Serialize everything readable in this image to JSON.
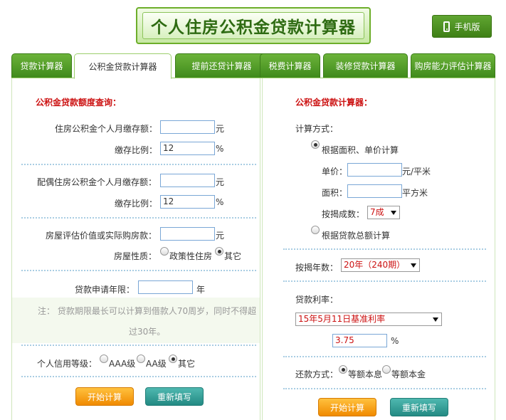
{
  "header": {
    "title": "个人住房公积金贷款计算器",
    "mobile_label": "手机版"
  },
  "tabs": [
    "贷款计算器",
    "公积金贷款计算器",
    "提前还贷计算器",
    "税费计算器",
    "装修贷款计算器",
    "购房能力评估计算器"
  ],
  "active_tab": 1,
  "left": {
    "title": "公积金贷款额度查询：",
    "personal_deposit_label": "住房公积金个人月缴存额：",
    "unit_yuan": "元",
    "rate_label": "缴存比例：",
    "rate_value": "12",
    "percent": "%",
    "spouse_deposit_label": "配偶住房公积金个人月缴存额：",
    "spouse_rate_value": "12",
    "house_value_label": "房屋评估价值或实际购房款：",
    "nature_label": "房屋性质：",
    "nature_opt1": "政策性住房",
    "nature_opt2": "其它",
    "term_label": "贷款申请年限：",
    "term_unit": "年",
    "note_line1": "注： 贷款期限最长可以计算到借款人70周岁，同时不得超",
    "note_line2": "过30年。",
    "credit_label": "个人信用等级：",
    "credit_opt1": "AAA级",
    "credit_opt2": "AA级",
    "credit_opt3": "其它",
    "start_button": "开始计算",
    "reset_button": "重新填写"
  },
  "right": {
    "title": "公积金贷款计算器：",
    "method_label": "计算方式：",
    "method_opt1": "根据面积、单价计算",
    "price_label": "单价：",
    "price_unit": "元/平米",
    "area_label": "面积：",
    "area_unit": "平方米",
    "ratio_label": "按揭成数：",
    "ratio_value": "7成",
    "method_opt2": "根据贷款总额计算",
    "years_label": "按揭年数：",
    "years_value": "20年（240期）",
    "interest_label": "贷款利率：",
    "interest_select": "15年5月11日基准利率",
    "interest_value": "3.75",
    "percent": "%",
    "repay_label": "还款方式：",
    "repay_opt1": "等额本息",
    "repay_opt2": "等额本金",
    "start_button": "开始计算",
    "reset_button": "重新填写"
  }
}
